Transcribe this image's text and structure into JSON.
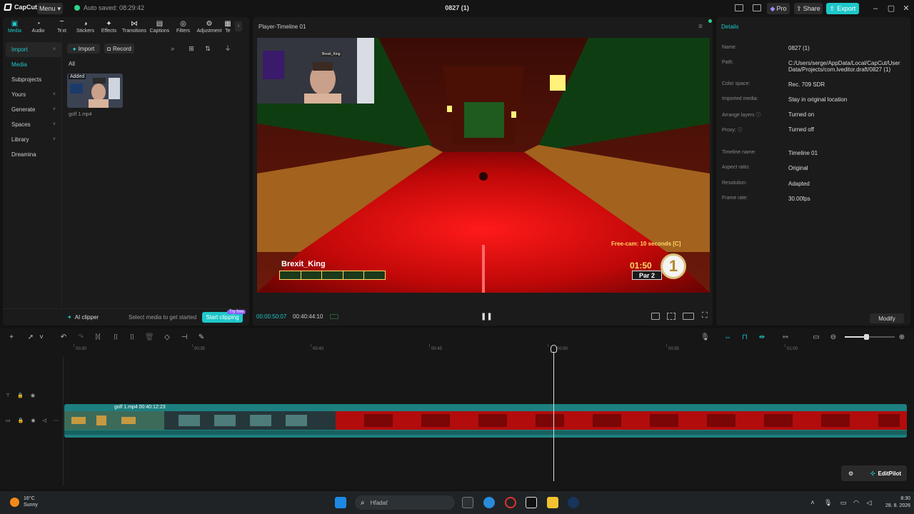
{
  "app": {
    "name": "CapCut",
    "menu_label": "Menu",
    "autosave": "Auto saved: 08:29:42",
    "project_title": "0827 (1)",
    "pro_label": "Pro",
    "share_label": "Share",
    "export_label": "Export",
    "accent_color": "#1fc7c9"
  },
  "tool_tabs": [
    {
      "label": "Media",
      "icon": "media-icon",
      "glyph": "▣"
    },
    {
      "label": "Audio",
      "icon": "audio-icon",
      "glyph": "◔"
    },
    {
      "label": "Text",
      "icon": "text-icon",
      "glyph": "T"
    },
    {
      "label": "Stickers",
      "icon": "sticker-icon",
      "glyph": "◑"
    },
    {
      "label": "Effects",
      "icon": "effects-icon",
      "glyph": "✦"
    },
    {
      "label": "Transitions",
      "icon": "transitions-icon",
      "glyph": "⋈"
    },
    {
      "label": "Captions",
      "icon": "captions-icon",
      "glyph": "▤"
    },
    {
      "label": "Filters",
      "icon": "filters-icon",
      "glyph": "◎"
    },
    {
      "label": "Adjustment",
      "icon": "adjustment-icon",
      "glyph": "⚙"
    },
    {
      "label": "Te",
      "icon": "templates-icon",
      "glyph": "▦"
    }
  ],
  "side_nav": {
    "import": "Import",
    "media": "Media",
    "subprojects": "Subprojects",
    "yours": "Yours",
    "generate": "Generate",
    "spaces": "Spaces",
    "library": "Library",
    "dreamina": "Dreamina"
  },
  "media_panel": {
    "import_btn": "Import",
    "record_btn": "Record",
    "filter_all": "All",
    "item_badge": "Added",
    "item_name": "golf 1.mp4"
  },
  "ai_bar": {
    "ai_clipper": "AI clipper",
    "hint": "Select media to get started",
    "start_btn": "Start clipping",
    "free_tag": "Try free"
  },
  "player": {
    "title": "Player-Timeline 01",
    "timecode_current": "00:00:50:07",
    "timecode_total": "00:40:44:10",
    "overlay": {
      "player_name": "Brexit_King",
      "freecam": "Free-cam: 10 seconds [C]",
      "time": "01:50",
      "par": "Par 2",
      "hole": "1",
      "webcam_tag": "Brexit_King"
    }
  },
  "details": {
    "title": "Details",
    "rows": [
      {
        "label": "Name:",
        "value": "0827 (1)"
      },
      {
        "label": "Path:",
        "value": "C:/Users/serge/AppData/Local/CapCut/User Data/Projects/com.lveditor.draft/0827 (1)"
      },
      {
        "label": "Color space:",
        "value": "Rec. 709 SDR"
      },
      {
        "label": "Imported media:",
        "value": "Stay in original location"
      },
      {
        "label": "Arrange layers ⓘ",
        "value": "Turned on"
      },
      {
        "label": "Proxy: ⓘ",
        "value": "Turned off"
      },
      {
        "label": "Timeline name:",
        "value": "Timeline 01"
      },
      {
        "label": "Aspect ratio:",
        "value": "Original"
      },
      {
        "label": "Resolution:",
        "value": "Adapted"
      },
      {
        "label": "Frame rate:",
        "value": "30.00fps"
      }
    ],
    "modify_btn": "Modify"
  },
  "timeline": {
    "ruler_labels": [
      "00:30",
      "00:35",
      "00:40",
      "00:45",
      "00:50",
      "00:55",
      "01:00"
    ],
    "clip_label": "golf 1.mp4   00:40:12:23",
    "editpilot": "EditPilot"
  },
  "taskbar": {
    "temperature": "16°C",
    "weather": "Sunny",
    "search_placeholder": "Hľadať",
    "time": "8:30",
    "date": "28. 8. 2026"
  }
}
